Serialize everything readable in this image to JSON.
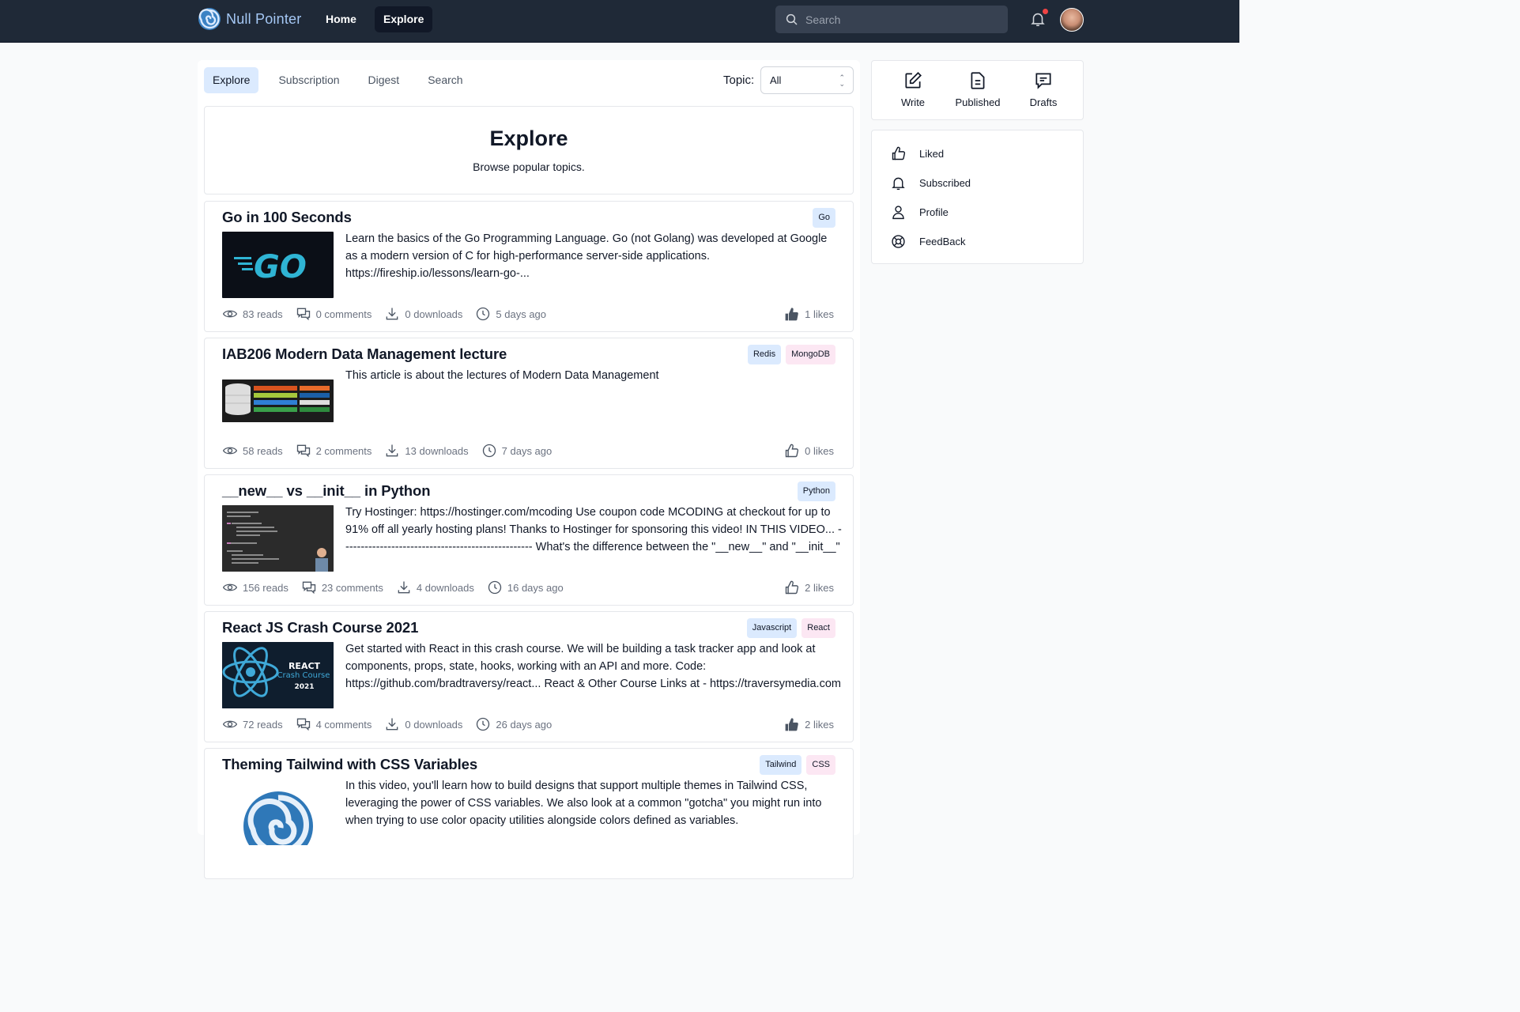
{
  "header": {
    "brand": "Null Pointer",
    "nav": [
      {
        "label": "Home",
        "active": false
      },
      {
        "label": "Explore",
        "active": true
      }
    ],
    "search_placeholder": "Search",
    "has_notification": true
  },
  "tabs": [
    {
      "label": "Explore",
      "active": true
    },
    {
      "label": "Subscription",
      "active": false
    },
    {
      "label": "Digest",
      "active": false
    },
    {
      "label": "Search",
      "active": false
    }
  ],
  "topic": {
    "label": "Topic:",
    "value": "All"
  },
  "hero": {
    "title": "Explore",
    "subtitle": "Browse popular topics."
  },
  "articles": [
    {
      "title": "Go in 100 Seconds",
      "tags": [
        {
          "label": "Go",
          "color": "blue"
        }
      ],
      "description": "Learn the basics of the Go Programming Language. Go (not Golang) was developed at Google as a modern version of C for high-performance server-side applications. https://fireship.io/lessons/learn-go-...",
      "reads": "83 reads",
      "comments": "0 comments",
      "downloads": "0 downloads",
      "time": "5 days ago",
      "likes": "1 likes",
      "liked": true,
      "thumb": "go"
    },
    {
      "title": "IAB206 Modern Data Management lecture",
      "tags": [
        {
          "label": "Redis",
          "color": "blue"
        },
        {
          "label": "MongoDB",
          "color": "pink"
        }
      ],
      "description": "This article is about the lectures of Modern Data Management",
      "reads": "58 reads",
      "comments": "2 comments",
      "downloads": "13 downloads",
      "time": "7 days ago",
      "likes": "0 likes",
      "liked": false,
      "thumb": "db"
    },
    {
      "title": "__new__ vs __init__ in Python",
      "tags": [
        {
          "label": "Python",
          "color": "blue"
        }
      ],
      "description": "Try Hostinger: https://hostinger.com/mcoding Use coupon code MCODING at checkout for up to 91% off all yearly hosting plans! Thanks to Hostinger for sponsoring this video! IN THIS VIDEO... -------------------------------------------------- What's the difference between the \"__new__\" and \"__init__\" magic methods in Python? New is for object creation, and init...",
      "reads": "156 reads",
      "comments": "23 comments",
      "downloads": "4 downloads",
      "time": "16 days ago",
      "likes": "2 likes",
      "liked": false,
      "thumb": "code"
    },
    {
      "title": "React JS Crash Course 2021",
      "tags": [
        {
          "label": "Javascript",
          "color": "blue"
        },
        {
          "label": "React",
          "color": "pink"
        }
      ],
      "description": "Get started with React in this crash course. We will be building a task tracker app and look at components, props, state, hooks, working with an API and more. Code: https://github.com/bradtraversy/react... React & Other Course Links at - https://traversymedia.com 💖 Support The Channel! http://www.patreon.com/traversymedia",
      "reads": "72 reads",
      "comments": "4 comments",
      "downloads": "0 downloads",
      "time": "26 days ago",
      "likes": "2 likes",
      "liked": true,
      "thumb": "react",
      "thumb_text": [
        "REACT",
        "Crash Course",
        "2021"
      ]
    },
    {
      "title": "Theming Tailwind with CSS Variables",
      "tags": [
        {
          "label": "Tailwind",
          "color": "blue"
        },
        {
          "label": "CSS",
          "color": "pink"
        }
      ],
      "description": "In this video, you'll learn how to build designs that support multiple themes in Tailwind CSS, leveraging the power of CSS variables. We also look at a common \"gotcha\" you might run into when trying to use color opacity utilities alongside colors defined as variables.",
      "reads": "",
      "comments": "",
      "downloads": "",
      "time": "",
      "likes": "",
      "liked": false,
      "thumb": "spiral"
    }
  ],
  "actions": [
    {
      "label": "Write",
      "icon": "pencil-square-icon"
    },
    {
      "label": "Published",
      "icon": "document-icon"
    },
    {
      "label": "Drafts",
      "icon": "chat-bubble-icon"
    }
  ],
  "sidebar": [
    {
      "label": "Liked",
      "icon": "thumb-up-icon"
    },
    {
      "label": "Subscribed",
      "icon": "bell-icon"
    },
    {
      "label": "Profile",
      "icon": "user-icon"
    },
    {
      "label": "FeedBack",
      "icon": "lifebuoy-icon"
    }
  ]
}
